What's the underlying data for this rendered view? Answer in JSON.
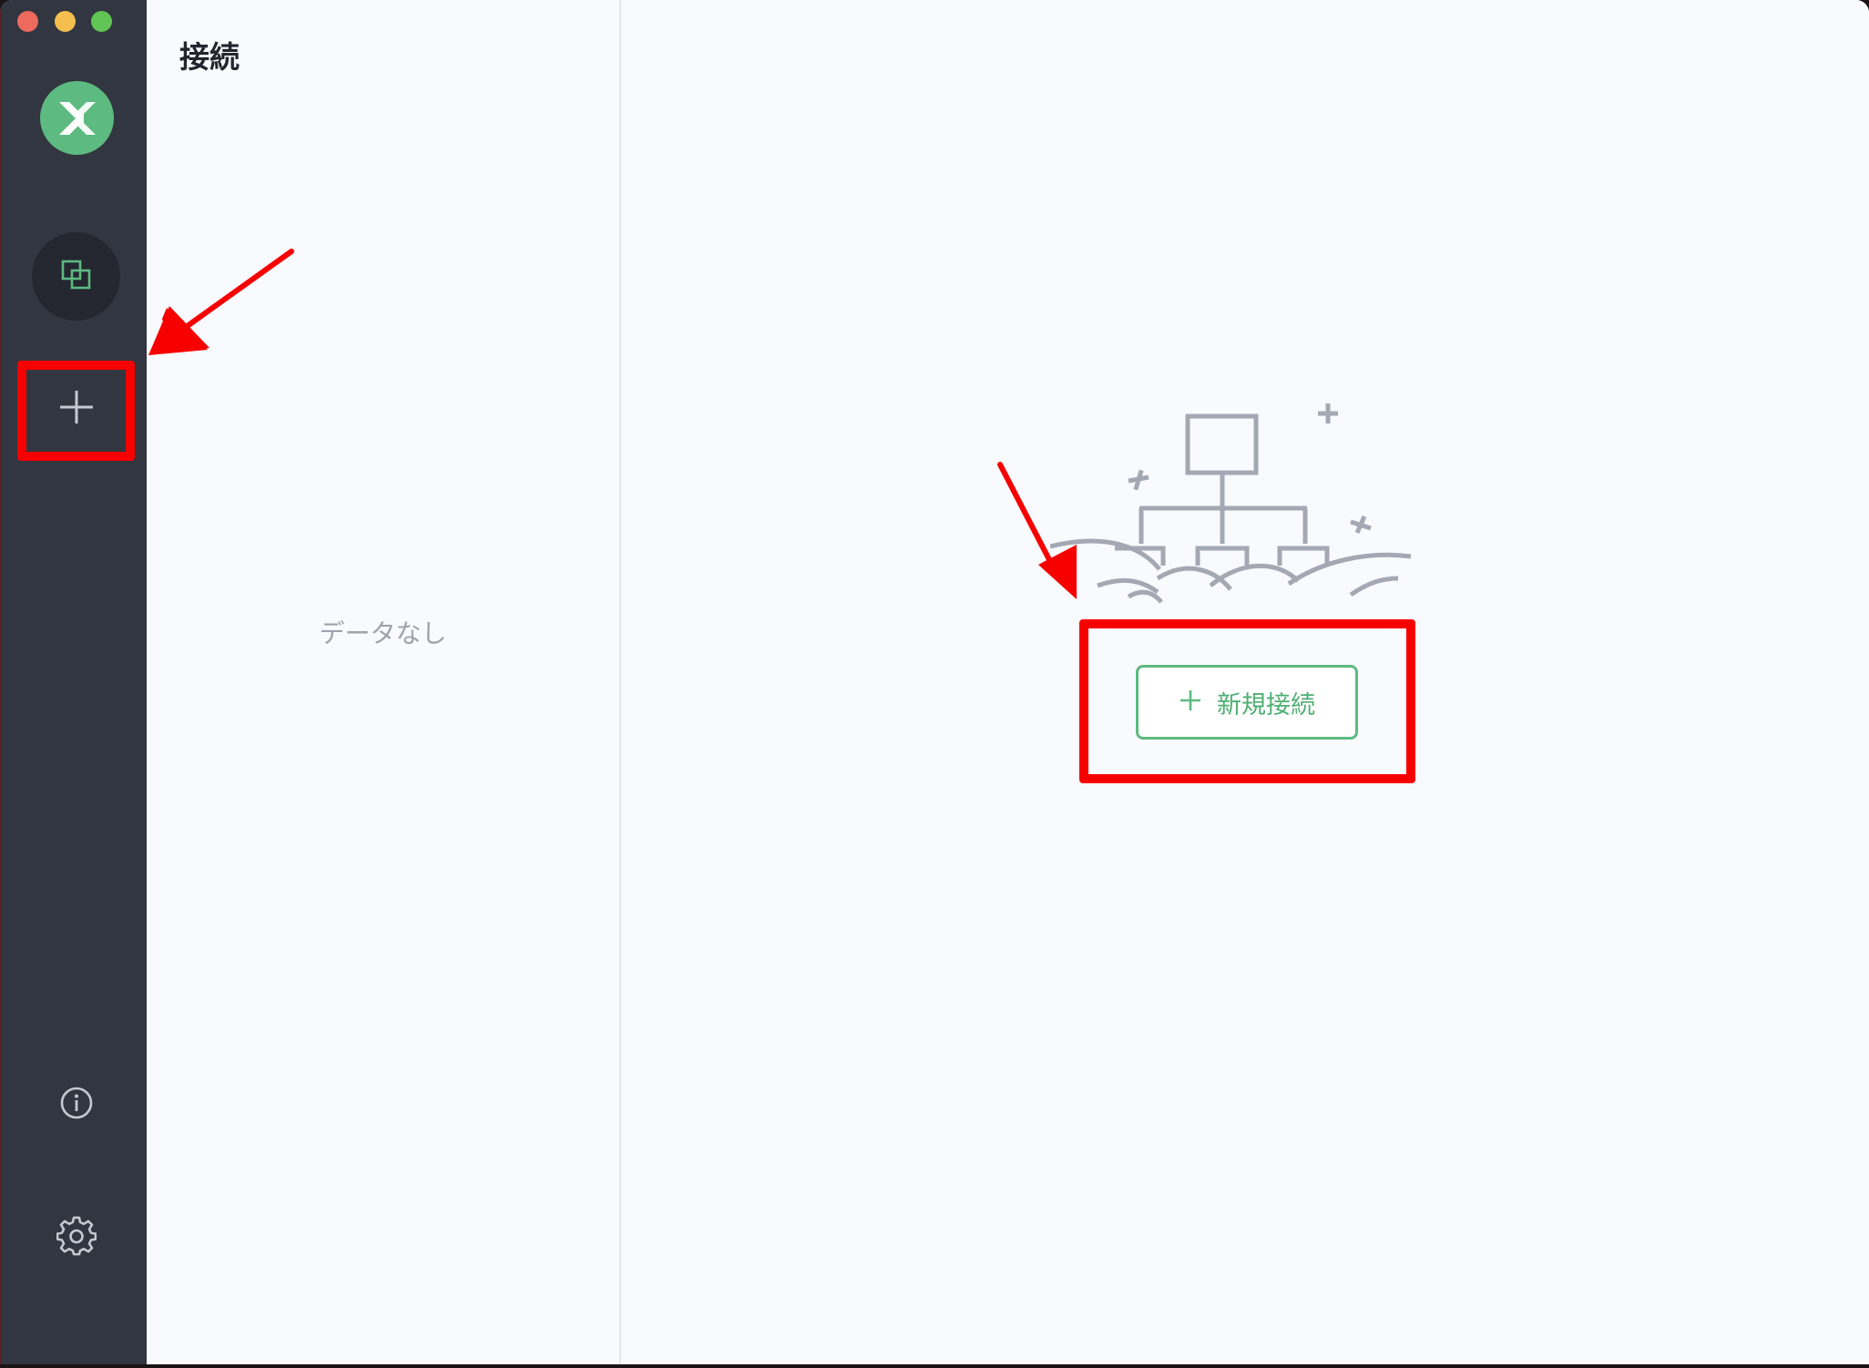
{
  "window": {
    "traffic_lights": [
      "close",
      "minimize",
      "maximize"
    ]
  },
  "rail": {
    "logo_icon": "app-logo-icon",
    "items": [
      {
        "name": "connections",
        "icon": "connections-icon",
        "active": true
      },
      {
        "name": "new-connection",
        "icon": "plus-icon",
        "active": false
      }
    ],
    "bottom_items": [
      {
        "name": "about",
        "icon": "info-icon"
      },
      {
        "name": "settings",
        "icon": "gear-icon"
      }
    ]
  },
  "list_panel": {
    "title": "接続",
    "empty_text": "データなし"
  },
  "main": {
    "illustration_icon": "network-illustration-icon",
    "new_connection_button": {
      "icon": "plus",
      "label": "新規接続"
    }
  },
  "colors": {
    "accent": "#5dba80",
    "rail_bg": "#323640",
    "annotation": "#f70000"
  }
}
